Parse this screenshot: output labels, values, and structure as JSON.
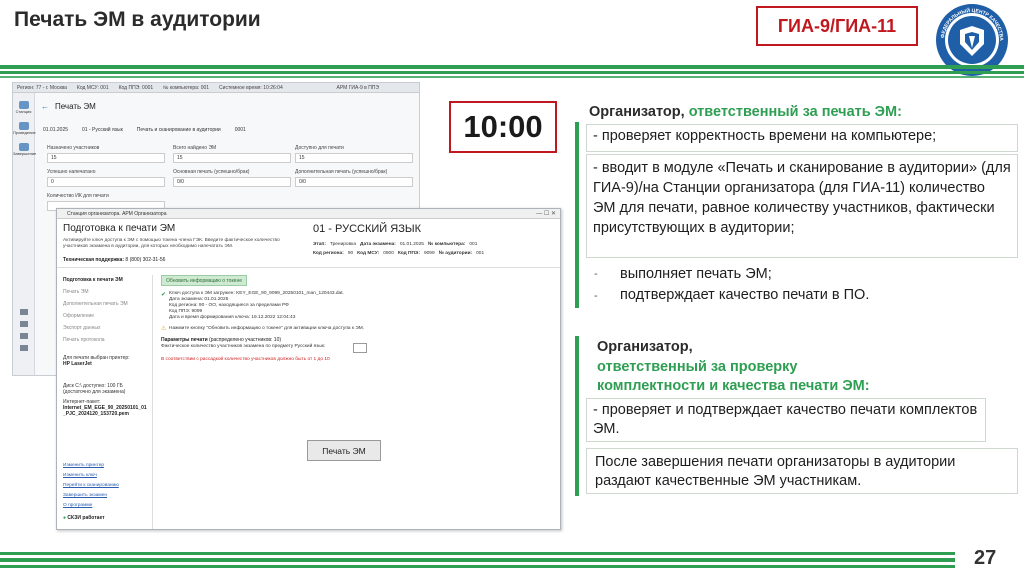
{
  "header": {
    "title": "Печать ЭМ в аудитории",
    "badge": "ГИА-9/ГИА-11",
    "emblem_text": "ФЕДЕРАЛЬНЫЙ ЦЕНТР КАЧЕСТВА ОБРАЗОВАНИЯ"
  },
  "timer": "10:00",
  "section1": {
    "title_prefix": "Организатор,",
    "title_green": "ответственный за печать ЭМ:",
    "items": [
      "- проверяет корректность времени на компьютере;",
      "- вводит в модуле «Печать и сканирование в аудитории» (для ГИА-9)/на Станции организатора (для ГИА-11) количество ЭМ для печати, равное количеству участников, фактически присутствующих в аудитории;"
    ],
    "bullets": [
      "выполняет печать ЭМ;",
      "подтверждает качество печати в ПО."
    ],
    "dash": "-"
  },
  "section2": {
    "title_prefix": "Организатор,",
    "title_green_1": "ответственный за проверку",
    "title_green_2": "комплектности и качества печати ЭМ:",
    "item": "- проверяет и подтверждает качество печати комплектов ЭМ.",
    "note": "После завершения печати организаторы в аудитории раздают качественные ЭМ участникам."
  },
  "page_number": "27",
  "screen1": {
    "top_bar": [
      "Регион: 77 - г. Москва",
      "Код МСУ: 001",
      "Код ППЭ: 0001",
      "№ компьютера: 001",
      "Системное время: 10:26:04"
    ],
    "app_title": "АРМ ГИА-9 в ППЭ",
    "side_items": [
      "Станция",
      "Проведение",
      "Завершение"
    ],
    "title": "Печать ЭМ",
    "info": [
      "01.01.2025",
      "01 - Русский язык",
      "Печать и сканирование в аудитории",
      "0001"
    ],
    "fields": [
      {
        "label": "Назначено участников",
        "value": "15"
      },
      {
        "label": "Всего найдено ЭМ",
        "value": "15"
      },
      {
        "label": "Доступно для печати",
        "value": "15"
      },
      {
        "label": "Успешно напечатано",
        "value": "0"
      },
      {
        "label": "Основная печать (успешно/брак)",
        "value": "0/0"
      },
      {
        "label": "Дополнительная печать (успешно/брак)",
        "value": "0/0"
      }
    ],
    "count_label": "Количество ИК для печати"
  },
  "screen2": {
    "window_title": "Станция организатора. АРМ Организатора",
    "title": "Подготовка к печати ЭМ",
    "desc": "Активируйте ключ доступа к ЭМ с помощью токена члена ГЭК. Введите фактическое количество участников экзамена в аудитории, для которых необходимо напечатать ЭМ.",
    "support_label": "Техническая поддержка:",
    "support_phone": "8 (800) 302-31-56",
    "subject": "01 - РУССКИЙ ЯЗЫК",
    "stage_label": "Этап:",
    "stage": "Тренировка",
    "exam_date_label": "Дата экзамена:",
    "exam_date": "01.01.2025",
    "pc_label": "№ компьютера:",
    "pc": "001",
    "region_label": "Код региона:",
    "region": "90",
    "msu_label": "Код МСУ:",
    "msu": "0900",
    "ppe_label": "Код ППЭ:",
    "ppe": "9099",
    "aud_label": "№ аудитории:",
    "aud": "001",
    "menu": [
      "Подготовка к печати ЭМ",
      "Печать ЭМ",
      "Дополнительная печать ЭМ",
      "Оформление",
      "Экспорт данных",
      "Печать протокола"
    ],
    "update_button": "Обновить информацию о токене",
    "key_info": [
      "Ключ доступа к ЭМ загружен: KEY_EGE_90_9099_20250101_man_120443.dat.",
      "Дата экзамена: 01.01.2025",
      "Код региона: 90 - ОО, находящиеся за пределами РФ",
      "Код ППЭ: 9099",
      "Дата и время формирования ключа: 19.12.2022 12:04:43"
    ],
    "warning": "Нажмите кнопку \"Обновить информацию о токене\" для активации ключа доступа к ЭМ.",
    "params_title": "Параметры печати",
    "params_hint": "(распределено участников: 10)",
    "params_label": "Фактическое количество участников экзамена по предмету Русский язык:",
    "params_error": "В соответствии с рассадкой количество участников должно быть от 1 до 10",
    "printer_label": "Для печати выбран принтер:",
    "printer": "HP LaserJet",
    "disk_label": "Диск С:\\ доступно: 100 ГБ",
    "disk_note": "(достаточно для экзамена)",
    "package_label": "Интернет-пакет:",
    "package": "Internet_EM_EGE_90_20250101_01_PJC_2024120_153720.pem",
    "links": [
      "Изменить принтер",
      "Изменить ключ",
      "Перейти к сканированию",
      "Завершить экзамен",
      "О программе"
    ],
    "skzi": "СКЗИ работает",
    "print_button": "Печать ЭМ"
  }
}
